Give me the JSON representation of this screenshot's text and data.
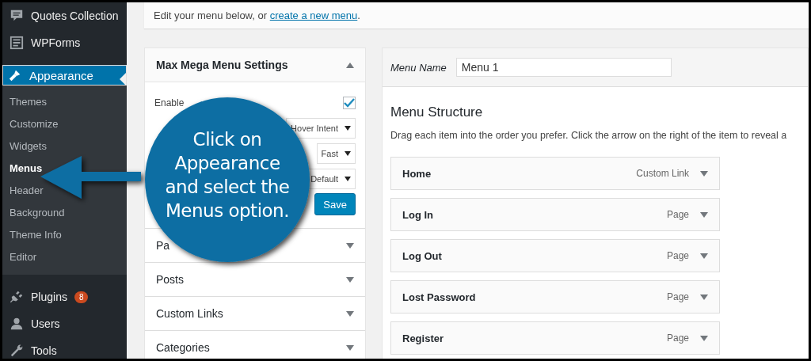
{
  "sidebar": {
    "items": [
      {
        "label": "Quotes Collection",
        "selected": false
      },
      {
        "label": "WPForms",
        "selected": false
      },
      {
        "label": "Appearance",
        "selected": true,
        "expanded": true,
        "children": [
          {
            "label": "Themes",
            "selected": false
          },
          {
            "label": "Customize",
            "selected": false
          },
          {
            "label": "Widgets",
            "selected": false
          },
          {
            "label": "Menus",
            "selected": true
          },
          {
            "label": "Header",
            "selected": false
          },
          {
            "label": "Background",
            "selected": false
          },
          {
            "label": "Theme Info",
            "selected": false
          },
          {
            "label": "Editor",
            "selected": false
          }
        ]
      },
      {
        "label": "Plugins",
        "selected": false,
        "badge": "8"
      },
      {
        "label": "Users",
        "selected": false
      },
      {
        "label": "Tools",
        "selected": false
      }
    ]
  },
  "notice": {
    "text": "Edit your menu below, or ",
    "link": "create a new menu",
    "end": "."
  },
  "left_panel": {
    "sections": [
      {
        "title": "Max Mega Menu Settings",
        "expanded": true,
        "settings": {
          "enable_label": "Enable",
          "enable_checked": true,
          "selects": [
            "Hover Intent",
            "Fast",
            "Default"
          ],
          "save": "Save"
        }
      },
      {
        "title": "Pa",
        "expanded": false
      },
      {
        "title": "Posts",
        "expanded": false
      },
      {
        "title": "Custom Links",
        "expanded": false
      },
      {
        "title": "Categories",
        "expanded": false
      }
    ]
  },
  "menu_editor": {
    "name_label": "Menu Name",
    "name_value": "Menu 1",
    "heading": "Menu Structure",
    "description": "Drag each item into the order you prefer. Click the arrow on the right of the item to reveal a",
    "items": [
      {
        "label": "Home",
        "type": "Custom Link"
      },
      {
        "label": "Log In",
        "type": "Page"
      },
      {
        "label": "Log Out",
        "type": "Page"
      },
      {
        "label": "Lost Password",
        "type": "Page"
      },
      {
        "label": "Register",
        "type": "Page"
      }
    ]
  },
  "callout": {
    "lines": [
      "Click on",
      "Appearance",
      "and select the",
      "Menus option."
    ]
  }
}
